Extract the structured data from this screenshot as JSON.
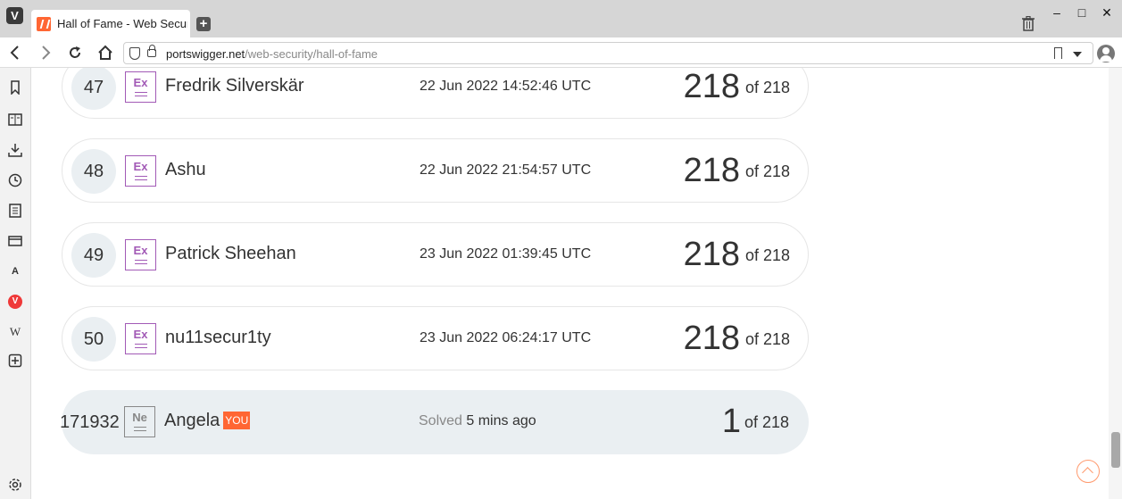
{
  "browser": {
    "logo_letter": "V",
    "tab_title": "Hall of Fame - Web Security Academy",
    "new_tab_symbol": "+",
    "url_domain": "portswigger.net",
    "url_path": "/web-security/hall-of-fame",
    "window_controls": [
      "–",
      "□",
      "✕"
    ]
  },
  "sidepanel": {
    "icons": [
      "bookmarks-icon",
      "reader-icon",
      "downloads-icon",
      "history-icon",
      "notes-icon",
      "window-icon",
      "translate-icon",
      "vivaldi-icon",
      "wikipedia-icon",
      "add-panel-icon",
      "settings-icon"
    ],
    "wikipedia_letter": "W",
    "translate_letter": "A"
  },
  "leaderboard": [
    {
      "rank": "47",
      "level": "Ex",
      "name": "Fredrik Silverskär",
      "date": "22 Jun 2022 14:52:46 UTC",
      "score": "218",
      "of": "of 218"
    },
    {
      "rank": "48",
      "level": "Ex",
      "name": "Ashu",
      "date": "22 Jun 2022 21:54:57 UTC",
      "score": "218",
      "of": "of 218"
    },
    {
      "rank": "49",
      "level": "Ex",
      "name": "Patrick Sheehan",
      "date": "23 Jun 2022 01:39:45 UTC",
      "score": "218",
      "of": "of 218"
    },
    {
      "rank": "50",
      "level": "Ex",
      "name": "nu11secur1ty",
      "date": "23 Jun 2022 06:24:17 UTC",
      "score": "218",
      "of": "of 218"
    }
  ],
  "current_user": {
    "rank": "171932",
    "level": "Ne",
    "name": "Angela",
    "you_tag": "YOU",
    "solved_label": "Solved",
    "solved_time": "5 mins ago",
    "score": "1",
    "of": "of 218"
  },
  "colors": {
    "expert_badge": "#a25ab6",
    "novice_badge": "#888888",
    "you_tag": "#ff6633",
    "row_highlight": "#eaeff2"
  }
}
